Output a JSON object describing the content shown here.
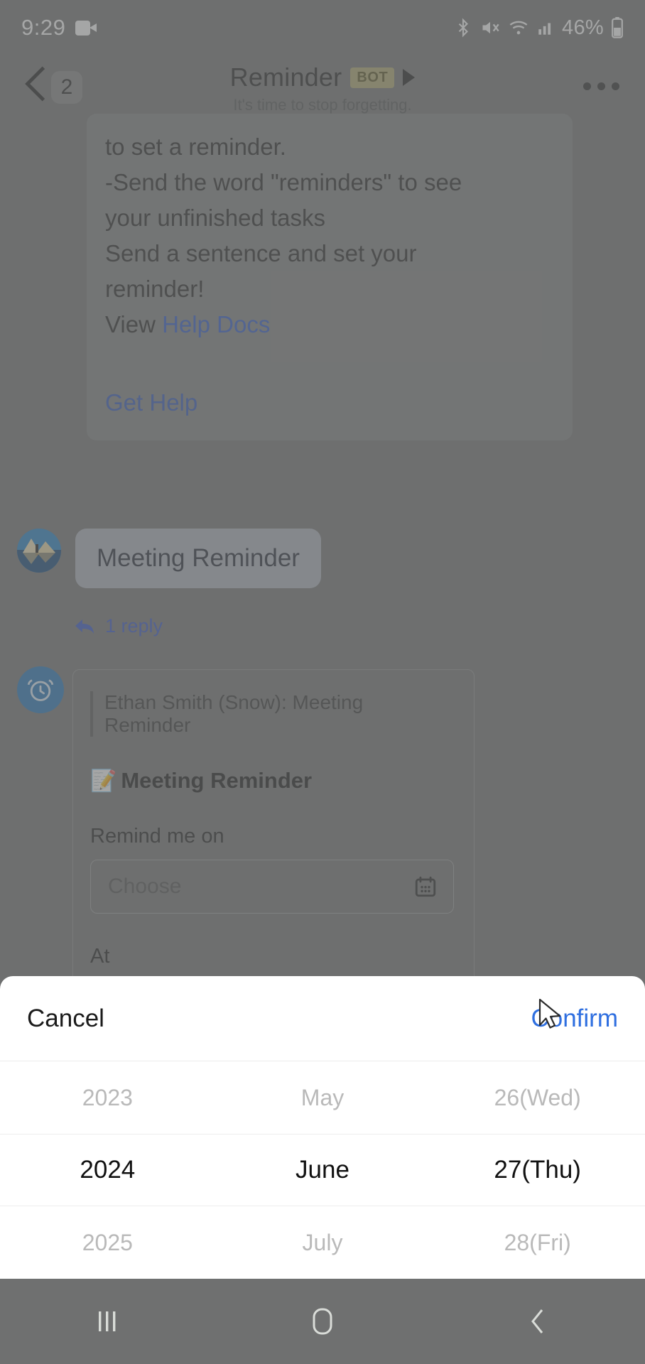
{
  "status_bar": {
    "time": "9:29",
    "camera_icon": "video-camera-icon",
    "bluetooth_icon": "bluetooth-icon",
    "mute_icon": "volume-mute-icon",
    "wifi_icon": "wifi-icon",
    "signal_icon": "cellular-signal-icon",
    "battery_percent": "46%",
    "battery_icon": "battery-icon"
  },
  "title_bar": {
    "back_icon": "back-chevron-icon",
    "unread_count": "2",
    "title": "Reminder",
    "bot_badge": "BOT",
    "expand_icon": "play-caret-icon",
    "subtitle": "It's time to stop forgetting.",
    "more_icon": "more-options-icon"
  },
  "chat": {
    "bot_message": {
      "lines": [
        "to set a reminder.",
        "-Send the word \"reminders\" to see",
        "your unfinished tasks",
        "Send a sentence and set your",
        "reminder!"
      ],
      "view_prefix": "View ",
      "help_docs_link": "Help Docs",
      "get_help_link": "Get Help"
    },
    "user_message": {
      "avatar": "user-avatar",
      "text": "Meeting Reminder",
      "reply_icon": "reply-arrow-icon",
      "reply_count": "1 reply"
    },
    "reminder_card": {
      "avatar": "alarm-clock-icon",
      "quote": "Ethan Smith (Snow): Meeting Reminder",
      "emoji": "📝",
      "title": "Meeting Reminder",
      "date_label": "Remind me on",
      "date_placeholder": "Choose",
      "date_value": "",
      "calendar_icon": "calendar-icon",
      "time_label": "At",
      "time_placeholder": "",
      "time_value": ""
    }
  },
  "date_picker": {
    "cancel_label": "Cancel",
    "confirm_label": "Confirm",
    "columns": [
      {
        "name": "year",
        "above": "2023",
        "selected": "2024",
        "below": "2025"
      },
      {
        "name": "month",
        "above": "May",
        "selected": "June",
        "below": "July"
      },
      {
        "name": "day",
        "above": "26(Wed)",
        "selected": "27(Thu)",
        "below": "28(Fri)"
      }
    ]
  },
  "nav_bar": {
    "recents_icon": "recent-apps-icon",
    "home_icon": "home-icon",
    "back_icon": "back-icon"
  },
  "cursor": {
    "icon": "mouse-pointer-icon"
  },
  "colors": {
    "accent_link": "#2f6fe0",
    "bot_badge_bg": "#d6c66b",
    "sheet_bg": "#ffffff",
    "backdrop": "#6f7070"
  }
}
